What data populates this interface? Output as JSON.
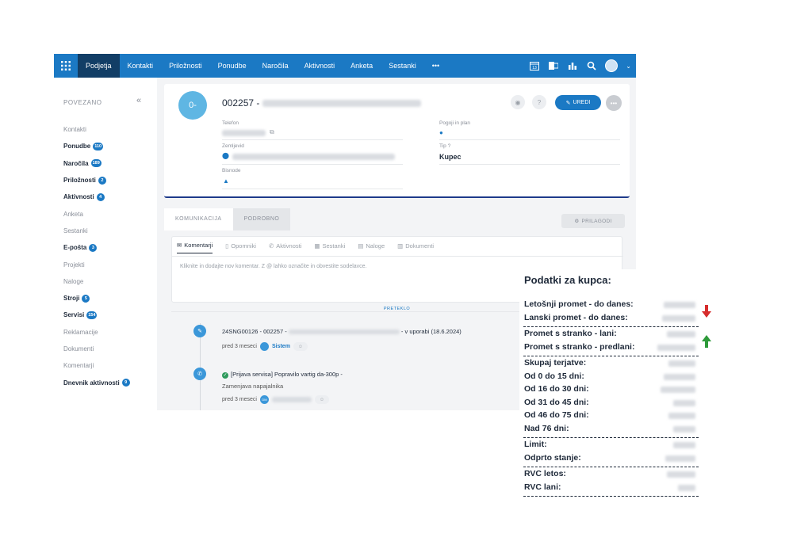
{
  "nav": {
    "items": [
      "Podjetja",
      "Kontakti",
      "Priložnosti",
      "Ponudbe",
      "Naročila",
      "Aktivnosti",
      "Anketa",
      "Sestanki",
      "•••"
    ],
    "active_index": 0,
    "calendar_day": "13"
  },
  "sidebar": {
    "heading": "POVEZANO",
    "collapse_icon": "«",
    "items": [
      {
        "label": "Kontakti",
        "badge": ""
      },
      {
        "label": "Ponudbe",
        "badge": "110"
      },
      {
        "label": "Naročila",
        "badge": "189"
      },
      {
        "label": "Priložnosti",
        "badge": "2"
      },
      {
        "label": "Aktivnosti",
        "badge": "4"
      },
      {
        "label": "Anketa",
        "badge": ""
      },
      {
        "label": "Sestanki",
        "badge": ""
      },
      {
        "label": "E-pošta",
        "badge": "3"
      },
      {
        "label": "Projekti",
        "badge": ""
      },
      {
        "label": "Naloge",
        "badge": ""
      },
      {
        "label": "Stroji",
        "badge": "5"
      },
      {
        "label": "Servisi",
        "badge": "154"
      },
      {
        "label": "Reklamacije",
        "badge": ""
      },
      {
        "label": "Dokumenti",
        "badge": ""
      },
      {
        "label": "Komentarji",
        "badge": ""
      },
      {
        "label": "Dnevnik aktivnosti",
        "badge": "9"
      }
    ]
  },
  "record": {
    "avatar": "0-",
    "title_prefix": "002257 -",
    "edit_label": "UREDI",
    "more_label": "•••",
    "fields": {
      "telefon_label": "Telefon",
      "zemljevid_label": "Zemljevid",
      "bisnode_label": "Bisnode",
      "pogoji_label": "Pogoji in plan",
      "tip_label": "Tip",
      "tip_value": "Kupec"
    }
  },
  "tabs": {
    "items": [
      "KOMUNIKACIJA",
      "PODROBNO"
    ],
    "customize_label": "PRILAGODI"
  },
  "comment_panel": {
    "sub_tabs": [
      "Komentarji",
      "Opomniki",
      "Aktivnosti",
      "Sestanki",
      "Naloge",
      "Dokumenti"
    ],
    "placeholder": "Kliknite in dodajte nov komentar. Z @ lahko označite in obvestite sodelavce."
  },
  "timeline": {
    "divider_label": "PRETEKLO",
    "entries": [
      {
        "title_start": "24SNG00126 - 002257 -",
        "title_end": "- v uporabi (18.6.2024)",
        "time": "pred 3 meseci",
        "user": "Sistem",
        "subtitle": ""
      },
      {
        "title_start": "[Prijava servisa] Popravilo vartig da-300p -",
        "title_end": "",
        "time": "pred 3 meseci",
        "user": "",
        "subtitle": "Zamenjava napajalnika",
        "chip": "DM"
      }
    ]
  },
  "customer_info": {
    "title": "Podatki za kupca:",
    "groups": [
      [
        "Letošnji promet - do danes:",
        "Lanski promet - do danes:"
      ],
      [
        "Promet s stranko - lani:",
        "Promet s stranko - predlani:"
      ],
      [
        "Skupaj terjatve:",
        "Od 0 do 15 dni:",
        "Od 16 do 30 dni:",
        "Od 31 do 45 dni:",
        "Od 46 do 75 dni:",
        "Nad 76 dni:"
      ],
      [
        "Limit:",
        "Odprto stanje:"
      ],
      [
        "RVC letos:",
        "RVC lani:"
      ]
    ],
    "trend_colors": {
      "down": "#d62c2c",
      "up": "#2e9a3a"
    }
  }
}
